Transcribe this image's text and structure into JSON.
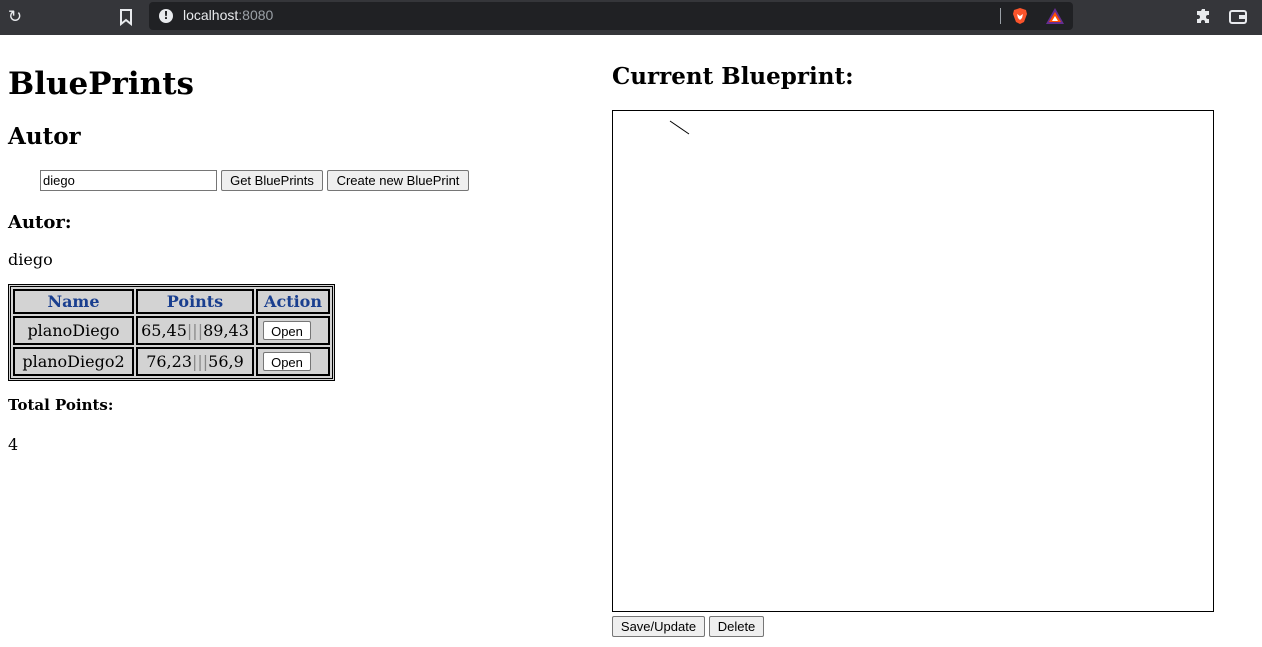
{
  "browser": {
    "url_host": "localhost",
    "url_port": ":8080"
  },
  "page": {
    "title": "BluePrints",
    "autor_heading": "Autor",
    "author_input_value": "diego",
    "get_button": "Get BluePrints",
    "create_button": "Create new BluePrint",
    "author_label": "Autor:",
    "author_name": "diego",
    "table": {
      "headers": [
        "Name",
        "Points",
        "Action"
      ],
      "rows": [
        {
          "name": "planoDiego",
          "points_a": "65,45",
          "points_b": "89,43",
          "action": "Open"
        },
        {
          "name": "planoDiego2",
          "points_a": "76,23",
          "points_b": "56,9",
          "action": "Open"
        }
      ]
    },
    "total_label": "Total Points:",
    "total_value": "4"
  },
  "current": {
    "heading": "Current Blueprint:",
    "save_button": "Save/Update",
    "delete_button": "Delete"
  },
  "colors": {
    "header_text": "#1a3f8f",
    "table_bg": "#d3d3d3",
    "chrome_bg": "#35363a"
  }
}
